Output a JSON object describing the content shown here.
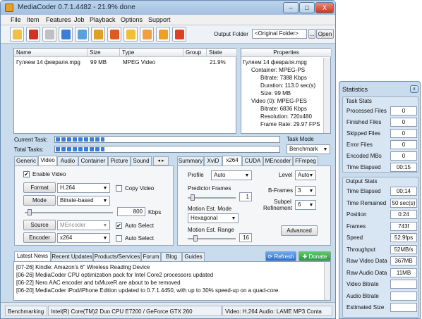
{
  "window": {
    "title": "MediaCoder 0.7.1.4482 - 21.9% done",
    "controls": [
      "–",
      "□",
      "X"
    ]
  },
  "menu": [
    "File",
    "Item",
    "Features",
    "Job",
    "Playback",
    "Options",
    "Support"
  ],
  "toolbar": {
    "icons": [
      "add-file-icon",
      "remove-icon",
      "clear-icon",
      "play-icon",
      "media-info-icon",
      "wizard-icon",
      "transcode-icon",
      "list-icon",
      "tools-icon",
      "pause-icon",
      "stop-icon"
    ],
    "output_folder_label": "Output Folder",
    "output_folder_value": "<Original Folder>",
    "browse_label": "...",
    "open_label": "Open"
  },
  "file_list": {
    "columns": [
      "Name",
      "Size",
      "Type",
      "Group",
      "State"
    ],
    "rows": [
      {
        "name": "Гуляем 14 февраля.mpg",
        "size": "99 MB",
        "type": "MPEG Video",
        "group": "",
        "state": "21.9%"
      }
    ]
  },
  "properties": {
    "header": "Properties",
    "rows": [
      "Гуляем 14 февраля.mpg",
      "Container: MPEG-PS",
      "Bitrate: 7388 Kbps",
      "Duration: 113.0 sec(s)",
      "Size: 99 MB",
      "Video (0): MPEG-PES",
      "Bitrate: 6836 Kbps",
      "Resolution: 720x480",
      "Frame Rate: 29.97 FPS"
    ]
  },
  "progress": {
    "current_label": "Current Task:",
    "total_label": "Total Tasks:",
    "current_value": 0.219,
    "total_value": 0.219
  },
  "task_mode": {
    "label": "Task Mode",
    "value": "Benchmark"
  },
  "left_tabs": [
    "Generic",
    "Video",
    "Audio",
    "Container",
    "Picture",
    "Sound"
  ],
  "left_tab_arrows": "◂ ▸",
  "video": {
    "enable_label": "Enable Video",
    "enable_check": "✔",
    "format_button": "Format",
    "format_value": "H.264",
    "copy_video_label": "Copy Video",
    "mode_button": "Mode",
    "mode_value": "Bitrate-based",
    "bitrate_value": "800",
    "bitrate_unit": "Kbps",
    "source_button": "Source",
    "source_value": "MEncoder",
    "auto_select_label": "Auto Select",
    "auto_check": "✔",
    "encoder_button": "Encoder",
    "encoder_value": "x264",
    "auto_select2_label": "Auto Select"
  },
  "right_tabs": [
    "Summary",
    "XviD",
    "x264",
    "CUDA",
    "MEncoder",
    "FFmpeg"
  ],
  "x264": {
    "profile_label": "Profile",
    "profile_value": "Auto",
    "level_label": "Level",
    "level_value": "Auto",
    "predictor_label": "Predictor Frames",
    "predictor_value": "1",
    "bframes_label": "B-Frames",
    "bframes_value": "3",
    "motion_mode_label": "Motion Est. Mode",
    "motion_mode_value": "Hexagonal",
    "subpel_label": "Subpel",
    "refinement_label": "Refinement",
    "subpel_value": "6",
    "motion_range_label": "Motion Est. Range",
    "motion_range_value": "16",
    "advanced_label": "Advanced"
  },
  "news_tabs": [
    "Latest News",
    "Recent Updates",
    "Products/Services",
    "Forum",
    "Blog",
    "Guides"
  ],
  "refresh_label": "Refresh",
  "donate_label": "Donate",
  "news": [
    "[07-26] Kindle: Amazon's 6\" Wireless Reading Device",
    "[06-26] MediaCoder CPU optimization pack for Intel Core2 processors updated",
    "[06-22] Nero AAC encoder and txMuxeR are about to be removed",
    "[06-20] MediaCoder iPod/iPhone Edition updated to 0.7.1.4450, with up to 30% speed-up on a quad-core."
  ],
  "status": {
    "mode": "Benchmarking",
    "hardware": "Intel(R) Core(TM)2 Duo CPU E7200 / GeForce GTX 260",
    "codecs": "Video: H.264  Audio: LAME MP3  Conta"
  },
  "statistics": {
    "title": "Statistics",
    "close_label": "x",
    "task_stats_title": "Task Stats",
    "task_stats": [
      {
        "label": "Processed Files",
        "value": "0"
      },
      {
        "label": "Finished Files",
        "value": "0"
      },
      {
        "label": "Skipped Files",
        "value": "0"
      },
      {
        "label": "Error Files",
        "value": "0"
      },
      {
        "label": "Encoded MBs",
        "value": "0"
      },
      {
        "label": "Time Elapsed",
        "value": "00:15"
      }
    ],
    "output_stats_title": "Output Stats",
    "output_stats": [
      {
        "label": "Time Elapsed",
        "value": "00:14"
      },
      {
        "label": "Time Remained",
        "value": "50 sec(s)"
      },
      {
        "label": "Position",
        "value": "0:24"
      },
      {
        "label": "Frames",
        "value": "743f"
      },
      {
        "label": "Speed",
        "value": "52.9fps"
      },
      {
        "label": "Throughput",
        "value": "52MB/s"
      },
      {
        "label": "Raw Video Data",
        "value": "367MB"
      },
      {
        "label": "Raw Audio Data",
        "value": "11MB"
      },
      {
        "label": "Video Bitrate",
        "value": ""
      },
      {
        "label": "Audio Bitrate",
        "value": ""
      },
      {
        "label": "Estimated Size",
        "value": ""
      }
    ]
  },
  "colors": {
    "accent": "#3a7ed8",
    "window_bg": "#c8dcee",
    "donate_green": "#2e9a3e"
  }
}
